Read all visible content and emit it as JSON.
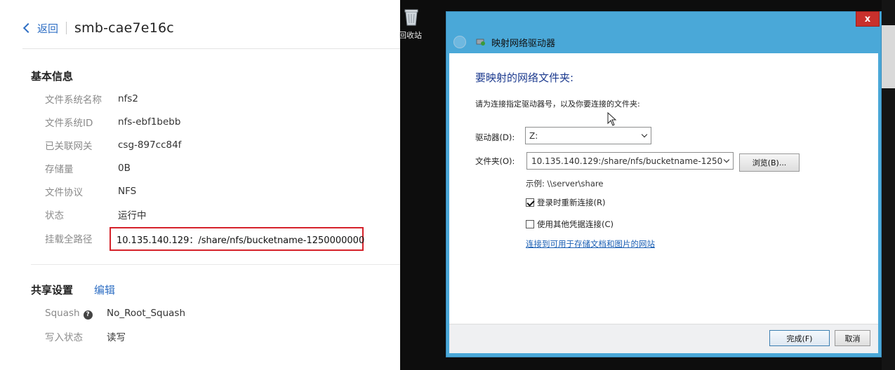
{
  "console": {
    "back_label": "返回",
    "title": "smb-cae7e16c",
    "basic_info": {
      "title": "基本信息",
      "rows": [
        {
          "label": "文件系统名称",
          "value": "nfs2"
        },
        {
          "label": "文件系统ID",
          "value": "nfs-ebf1bebb"
        },
        {
          "label": "已关联网关",
          "value": "csg-897cc84f"
        },
        {
          "label": "存储量",
          "value": "0B"
        },
        {
          "label": "文件协议",
          "value": "NFS"
        },
        {
          "label": "状态",
          "value": "运行中"
        },
        {
          "label": "挂载全路径",
          "value": "10.135.140.129：/share/nfs/bucketname-1250000000"
        }
      ]
    },
    "share_settings": {
      "title": "共享设置",
      "edit_label": "编辑",
      "rows": [
        {
          "label": "Squash",
          "value": "No_Root_Squash"
        },
        {
          "label": "写入状态",
          "value": "读写"
        }
      ]
    },
    "colors": {
      "link": "#2f6fc4",
      "status_running": "#28b05a",
      "highlight_border": "#d5222a"
    }
  },
  "desktop": {
    "recycle_bin_label": "回收站"
  },
  "dialog": {
    "title": "映射网络驱动器",
    "close_label": "x",
    "heading": "要映射的网络文件夹:",
    "instruction": "请为连接指定驱动器号，以及你要连接的文件夹:",
    "drive_label": "驱动器(D):",
    "drive_value": "Z:",
    "folder_label": "文件夹(O):",
    "folder_value": "10.135.140.129:/share/nfs/bucketname-1250",
    "browse_label": "浏览(B)...",
    "example": "示例: \\\\server\\share",
    "reconnect_label": "登录时重新连接(R)",
    "reconnect_checked": true,
    "other_credentials_label": "使用其他凭据连接(C)",
    "other_credentials_checked": false,
    "website_link": "连接到可用于存储文档和图片的网站",
    "finish_label": "完成(F)",
    "cancel_label": "取消",
    "colors": {
      "frame": "#4aa8d8",
      "close": "#c9302c",
      "heading": "#1d3b8f"
    }
  }
}
